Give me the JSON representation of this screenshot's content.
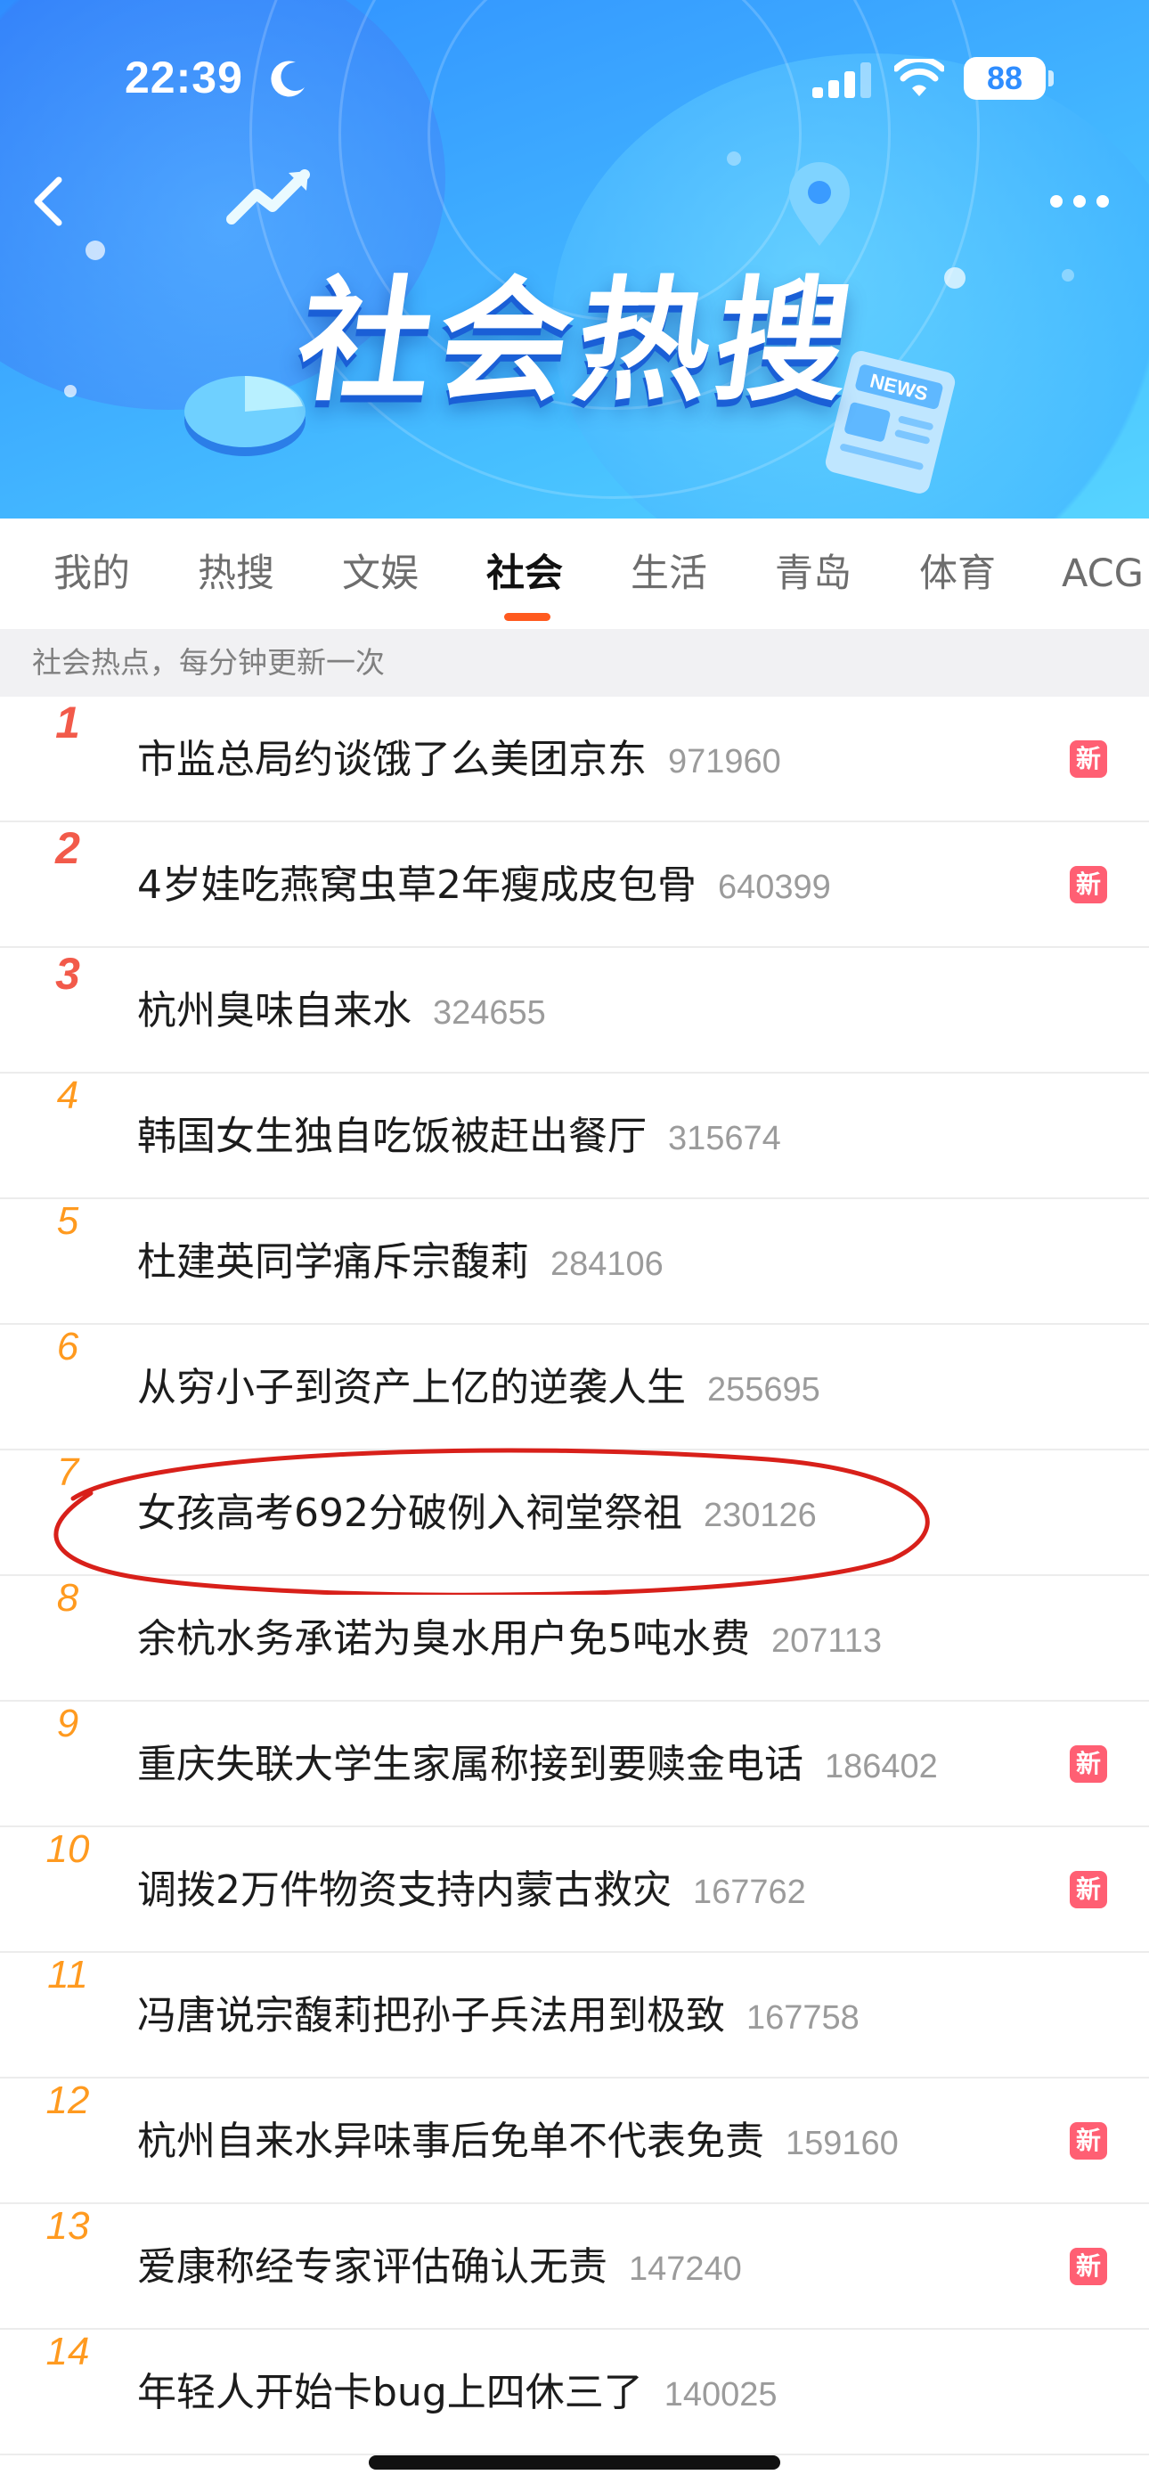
{
  "status_bar": {
    "time": "22:39",
    "battery": "88",
    "icons": [
      "moon-icon",
      "signal-icon",
      "wifi-icon",
      "battery-icon"
    ]
  },
  "header": {
    "banner_title": "社会热搜",
    "back_icon": "chevron-left-icon",
    "more_icon": "more-dots-icon",
    "news_badge_text": "NEWS"
  },
  "tabs": [
    {
      "label": "我的"
    },
    {
      "label": "热搜"
    },
    {
      "label": "文娱"
    },
    {
      "label": "社会",
      "active": true
    },
    {
      "label": "生活"
    },
    {
      "label": "青岛"
    },
    {
      "label": "体育"
    },
    {
      "label": "ACG"
    }
  ],
  "notice": "社会热点，每分钟更新一次",
  "new_badge_label": "新",
  "items": [
    {
      "rank": "1",
      "title": "市监总局约谈饿了么美团京东",
      "heat": "971960",
      "is_new": true
    },
    {
      "rank": "2",
      "title": "4岁娃吃燕窝虫草2年瘦成皮包骨",
      "heat": "640399",
      "is_new": true
    },
    {
      "rank": "3",
      "title": "杭州臭味自来水",
      "heat": "324655",
      "is_new": false
    },
    {
      "rank": "4",
      "title": "韩国女生独自吃饭被赶出餐厅",
      "heat": "315674",
      "is_new": false
    },
    {
      "rank": "5",
      "title": "杜建英同学痛斥宗馥莉",
      "heat": "284106",
      "is_new": false
    },
    {
      "rank": "6",
      "title": "从穷小子到资产上亿的逆袭人生",
      "heat": "255695",
      "is_new": false
    },
    {
      "rank": "7",
      "title": "女孩高考692分破例入祠堂祭祖",
      "heat": "230126",
      "is_new": false
    },
    {
      "rank": "8",
      "title": "余杭水务承诺为臭水用户免5吨水费",
      "heat": "207113",
      "is_new": false
    },
    {
      "rank": "9",
      "title": "重庆失联大学生家属称接到要赎金电话",
      "heat": "186402",
      "is_new": true
    },
    {
      "rank": "10",
      "title": "调拨2万件物资支持内蒙古救灾",
      "heat": "167762",
      "is_new": true
    },
    {
      "rank": "11",
      "title": "冯唐说宗馥莉把孙子兵法用到极致",
      "heat": "167758",
      "is_new": false
    },
    {
      "rank": "12",
      "title": "杭州自来水异味事后免单不代表免责",
      "heat": "159160",
      "is_new": true
    },
    {
      "rank": "13",
      "title": "爱康称经专家评估确认无责",
      "heat": "147240",
      "is_new": true
    },
    {
      "rank": "14",
      "title": "年轻人开始卡bug上四休三了",
      "heat": "140025",
      "is_new": false
    }
  ],
  "colors": {
    "accent_orange": "#ff5a1f",
    "rank_top": "#f25a4a",
    "rank_normal": "#ff9a1f",
    "new_badge": "#ff5f73",
    "annotation_red": "#d8201a"
  }
}
